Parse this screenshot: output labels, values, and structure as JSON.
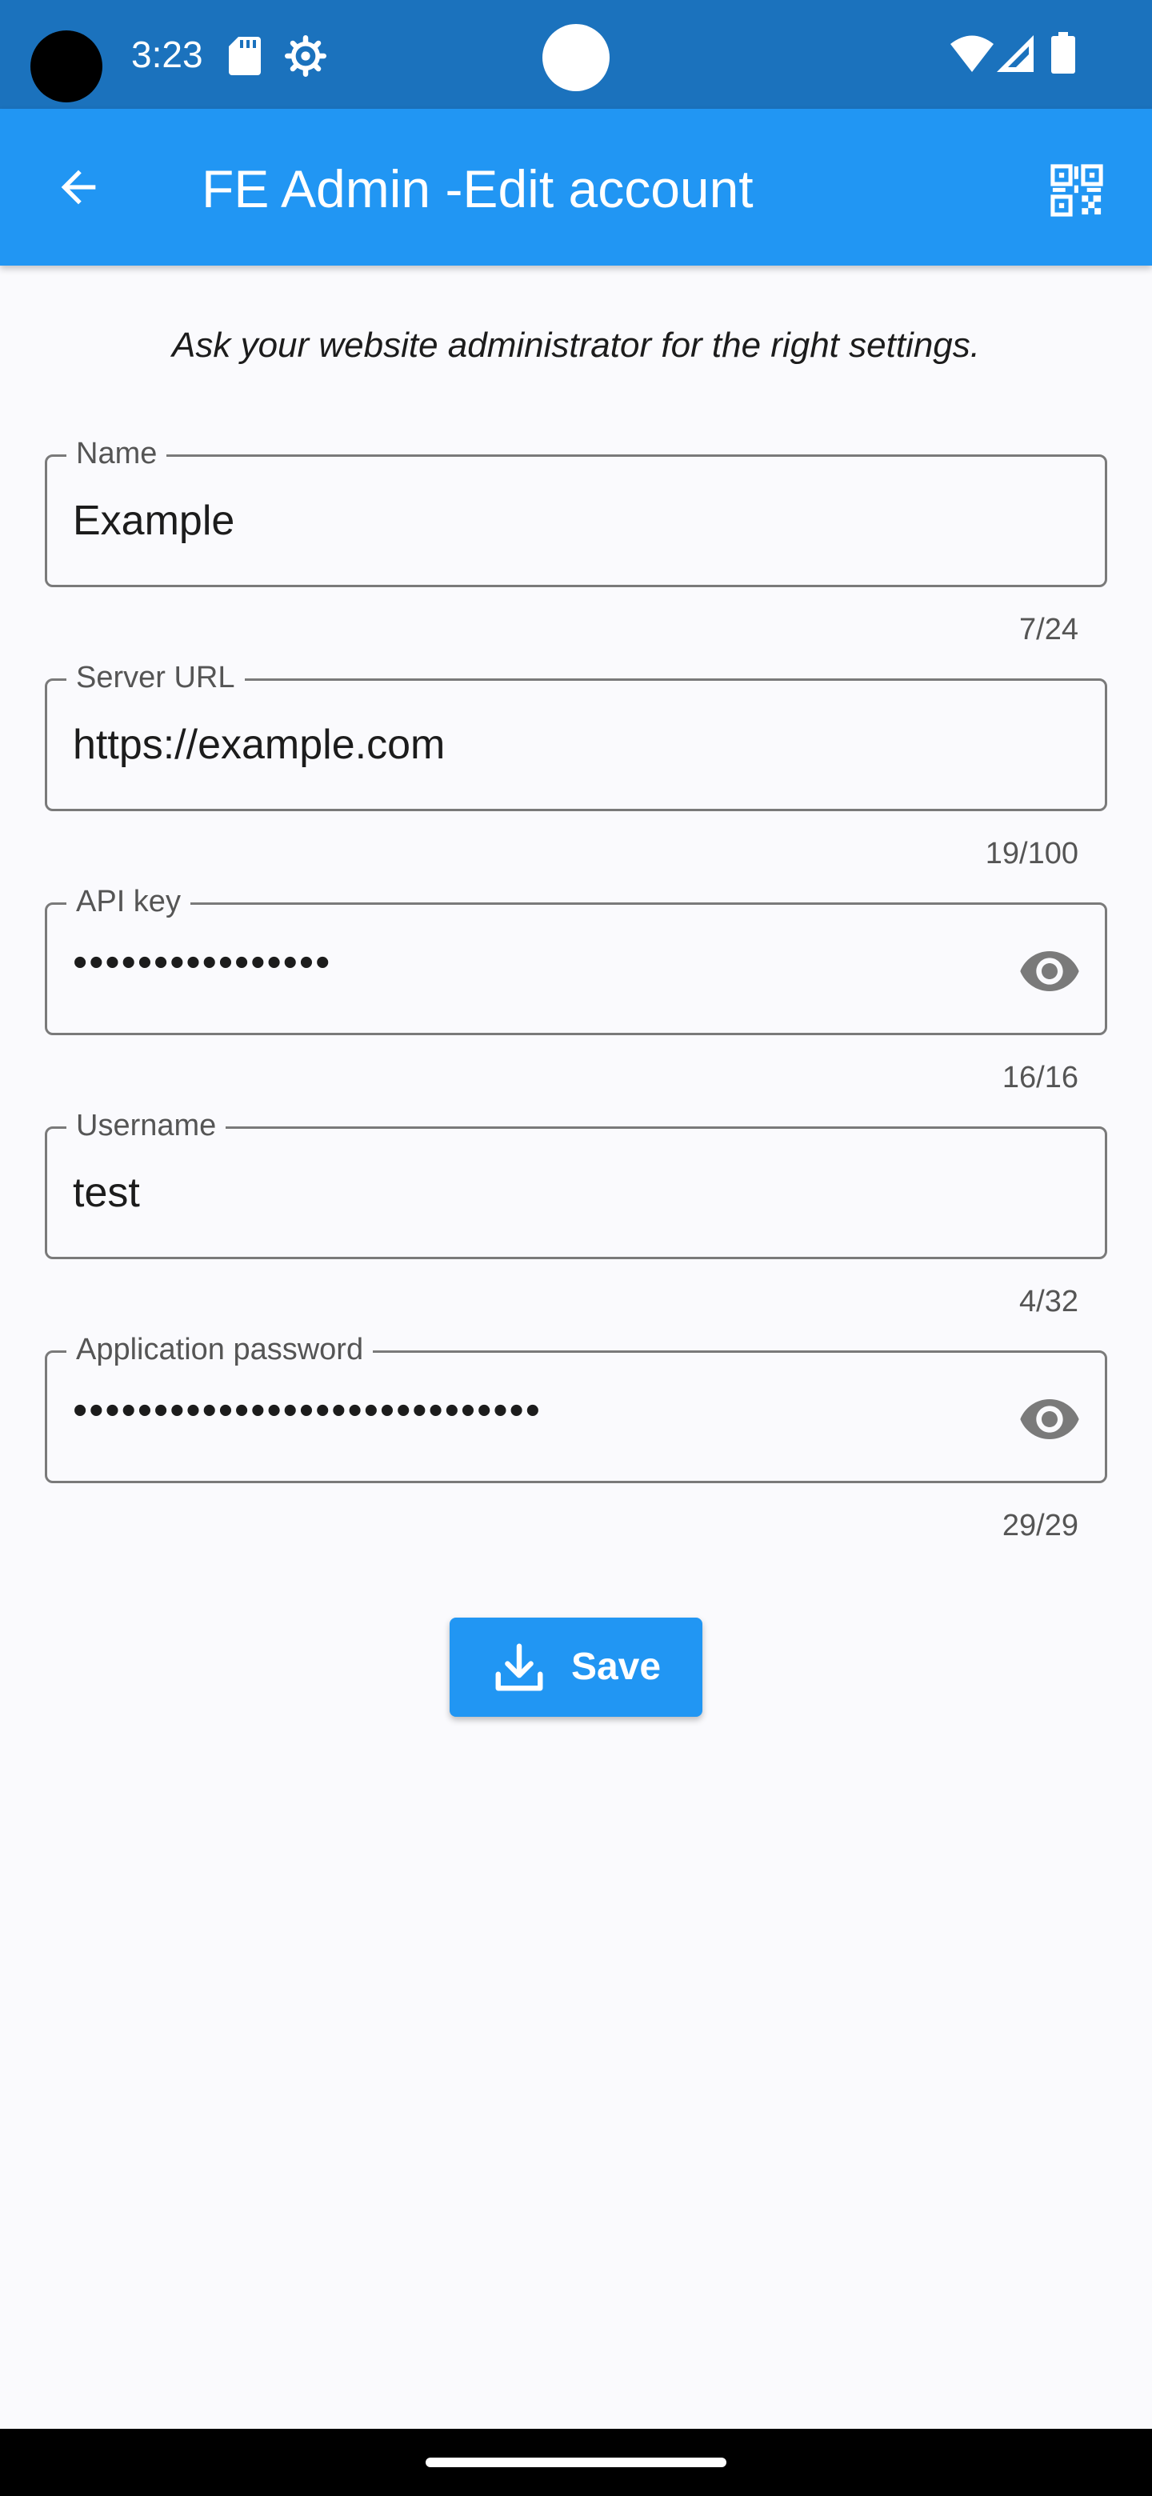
{
  "status_bar": {
    "time": "3:23",
    "icons": [
      "sd-card-icon",
      "gear-icon",
      "wifi-icon",
      "cellular-signal-icon",
      "battery-icon"
    ]
  },
  "app_bar": {
    "title": "FE Admin -Edit account",
    "back_icon": "arrow-back-icon",
    "qr_icon": "qr-scan-icon",
    "color": "#2196f3"
  },
  "hint": "Ask your website administrator for the right settings.",
  "fields": {
    "name": {
      "label": "Name",
      "value": "Example",
      "counter": "7/24"
    },
    "server_url": {
      "label": "Server URL",
      "value": "https://example.com",
      "counter": "19/100"
    },
    "api_key": {
      "label": "API key",
      "value": "••••••••••••••••",
      "counter": "16/16"
    },
    "username": {
      "label": "Username",
      "value": "test",
      "counter": "4/32"
    },
    "app_password": {
      "label": "Application password",
      "value": "•••••••••••••••••••••••••••••",
      "counter": "29/29"
    }
  },
  "save_button": {
    "label": "Save",
    "icon": "download-icon"
  }
}
